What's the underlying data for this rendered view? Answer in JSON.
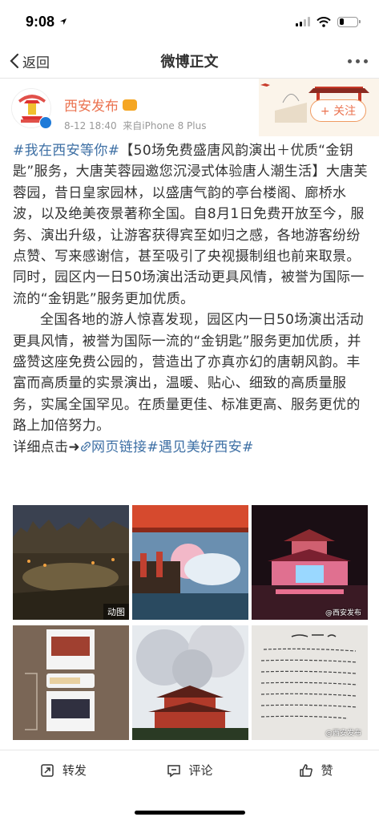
{
  "status_bar": {
    "time": "9:08",
    "icons": [
      "location-arrow-icon",
      "signal-icon",
      "wifi-icon",
      "battery-icon"
    ]
  },
  "nav": {
    "back_label": "返回",
    "title": "微博正文"
  },
  "post": {
    "author": "西安发布",
    "time": "8-12 18:40",
    "source": "来自iPhone 8 Plus",
    "follow_label": "+ 关注",
    "avatar_text": "西安发布",
    "topic1": "#我在西安等你#",
    "para1": "【50场免费盛唐风韵演出＋优质“金钥匙”服务，大唐芙蓉园邀您沉浸式体验唐人潮生活】大唐芙蓉园，昔日皇家园林，以盛唐气韵的亭台楼阁、廊桥水波，以及绝美夜景著称全国。自8月1日免费开放至今，服务、演出升级，让游客获得宾至如归之感，各地游客纷纷点赞、写来感谢信，甚至吸引了央视摄制组也前来取景。同时，园区内一日50场演出活动更具风情，被誉为国际一流的“金钥匙”服务更加优质。",
    "para2": "全国各地的游人惊喜发现，园区内一日50场演出活动更具风情，被誉为国际一流的“金钥匙”服务更加优质，并盛赞这座免费公园的，营造出了亦真亦幻的唐朝风韵。丰富而高质量的实景演出，温暖、贴心、细致的高质量服务，实属全国罕见。在质量更佳、标准更高、服务更优的路上加倍努力。",
    "detail_prefix": "详细点击➜",
    "web_link": "网页链接",
    "topic2": "#遇见美好西安#",
    "gif_tag": "动图",
    "watermark": "@西安发布"
  },
  "actions": {
    "repost": "转发",
    "comment": "评论",
    "like": "赞"
  },
  "colors": {
    "link": "#3d6fa4",
    "accent": "#eb7350",
    "verified": "#1e7ad8"
  }
}
